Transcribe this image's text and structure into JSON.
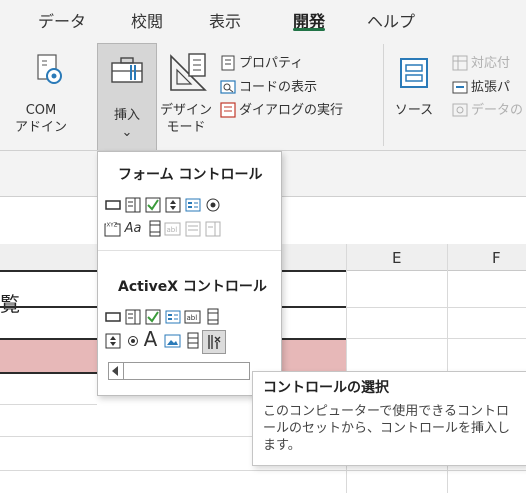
{
  "ribbon_tabs": [
    "データ",
    "校閲",
    "表示",
    "開発",
    "ヘルプ"
  ],
  "active_tab": "開発",
  "accent_color": "#217346",
  "buttons": {
    "com_addins_l1": "COM",
    "com_addins_l2": "アドイン",
    "insert_l1": "挿入",
    "insert_l2": "⌄",
    "design_mode_l1": "デザイン",
    "design_mode_l2": "モード",
    "properties": "プロパティ",
    "view_code": "コードの表示",
    "run_dialog": "ダイアログの実行",
    "source": "ソース",
    "map_properties": "対応付",
    "expansion_packs": "拡張パ",
    "refresh_data": "データの"
  },
  "dropdown": {
    "form_controls_title": "フォーム コントロール",
    "activex_controls_title": "ActiveX コントロール",
    "form_text_aa": "Aa",
    "form_text_abl": "abl",
    "form_text_xyz": "XYZ",
    "activex_text_abl": "abl",
    "activex_text_label": "A"
  },
  "sheet": {
    "col_e": "E",
    "col_f": "F",
    "cell_partial_text": "覧"
  },
  "tooltip": {
    "title": "コントロールの選択",
    "body": "このコンピューターで使用できるコントロールのセットから、コントロールを挿入します。"
  }
}
